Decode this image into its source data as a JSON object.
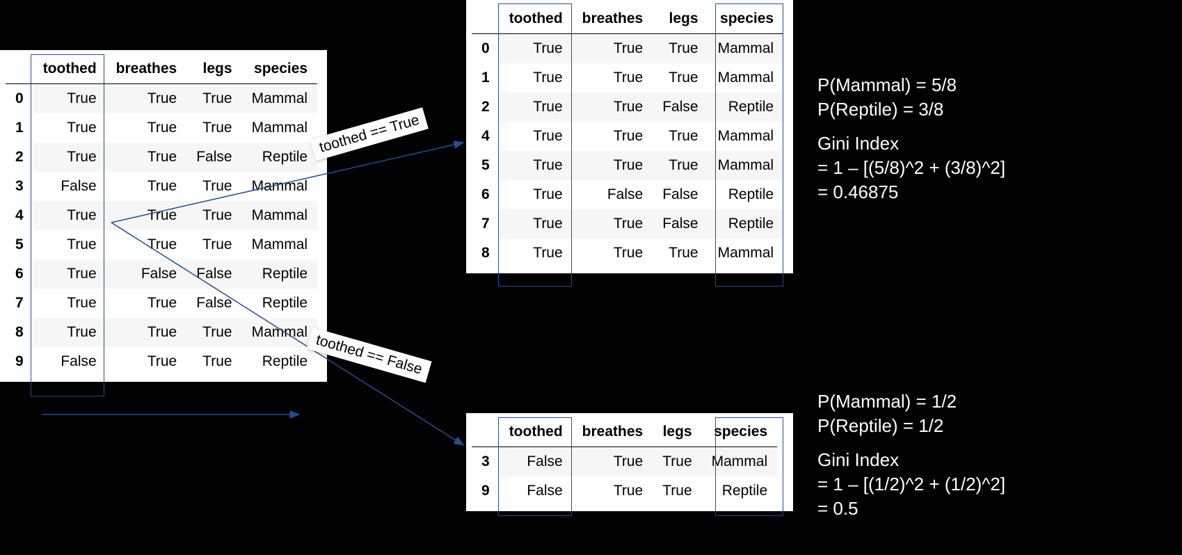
{
  "tables": {
    "left": {
      "columns": [
        "",
        "toothed",
        "breathes",
        "legs",
        "species"
      ],
      "rows": [
        [
          "0",
          "True",
          "True",
          "True",
          "Mammal"
        ],
        [
          "1",
          "True",
          "True",
          "True",
          "Mammal"
        ],
        [
          "2",
          "True",
          "True",
          "False",
          "Reptile"
        ],
        [
          "3",
          "False",
          "True",
          "True",
          "Mammal"
        ],
        [
          "4",
          "True",
          "True",
          "True",
          "Mammal"
        ],
        [
          "5",
          "True",
          "True",
          "True",
          "Mammal"
        ],
        [
          "6",
          "True",
          "False",
          "False",
          "Reptile"
        ],
        [
          "7",
          "True",
          "True",
          "False",
          "Reptile"
        ],
        [
          "8",
          "True",
          "True",
          "True",
          "Mammal"
        ],
        [
          "9",
          "False",
          "True",
          "True",
          "Reptile"
        ]
      ]
    },
    "top_right": {
      "columns": [
        "",
        "toothed",
        "breathes",
        "legs",
        "species"
      ],
      "rows": [
        [
          "0",
          "True",
          "True",
          "True",
          "Mammal"
        ],
        [
          "1",
          "True",
          "True",
          "True",
          "Mammal"
        ],
        [
          "2",
          "True",
          "True",
          "False",
          "Reptile"
        ],
        [
          "4",
          "True",
          "True",
          "True",
          "Mammal"
        ],
        [
          "5",
          "True",
          "True",
          "True",
          "Mammal"
        ],
        [
          "6",
          "True",
          "False",
          "False",
          "Reptile"
        ],
        [
          "7",
          "True",
          "True",
          "False",
          "Reptile"
        ],
        [
          "8",
          "True",
          "True",
          "True",
          "Mammal"
        ]
      ]
    },
    "bottom_right": {
      "columns": [
        "",
        "toothed",
        "breathes",
        "legs",
        "species"
      ],
      "rows": [
        [
          "3",
          "False",
          "True",
          "True",
          "Mammal"
        ],
        [
          "9",
          "False",
          "True",
          "True",
          "Reptile"
        ]
      ]
    }
  },
  "labels": {
    "arrow_true": "toothed == True",
    "arrow_false": "toothed == False"
  },
  "rhs": {
    "line1": "P(Mammal) = 5/8",
    "line2": "P(Reptile) = 3/8",
    "line3": "Gini Index",
    "line4": "= 1 – [(5/8)^2 + (3/8)^2]",
    "line5": "= 0.46875",
    "line6": "P(Mammal) = 1/2",
    "line7": "P(Reptile) = 1/2",
    "line8": "Gini Index",
    "line9": "= 1 – [(1/2)^2 + (1/2)^2]",
    "line10": "= 0.5"
  }
}
